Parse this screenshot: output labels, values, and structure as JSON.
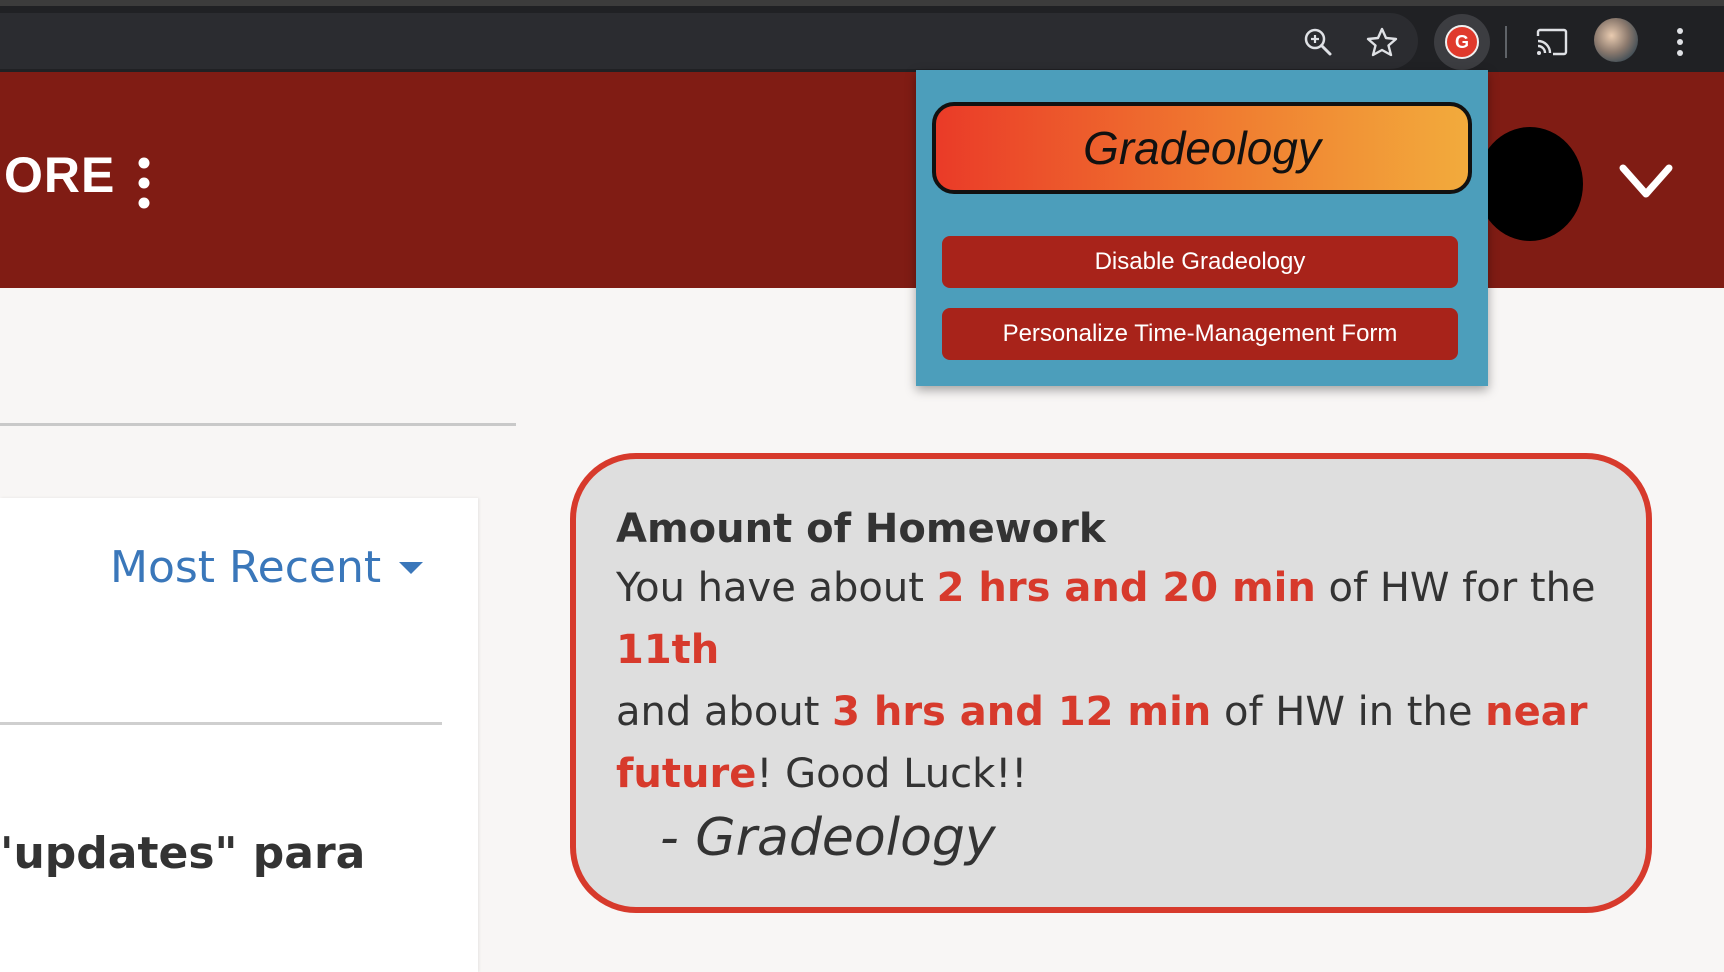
{
  "browser": {
    "icons": [
      "zoom-icon",
      "star-icon",
      "extension-icon",
      "cast-icon",
      "profile-avatar",
      "menu-icon"
    ],
    "extension_icon_letter": "G"
  },
  "header": {
    "nav_label": "ORE",
    "color": "#801c14"
  },
  "popup": {
    "title": "Gradeology",
    "buttons": {
      "disable": "Disable Gradeology",
      "personalize": "Personalize Time-Management Form"
    },
    "background": "#4c9ebb",
    "button_color": "#a8231a"
  },
  "feed": {
    "sort_label": "Most Recent",
    "post_snippet": "'updates\" para"
  },
  "homework": {
    "title": "Amount of Homework",
    "line1_prefix": "You have about ",
    "line1_amount": "2 hrs and 20 min",
    "line1_mid": " of HW for the ",
    "line1_day": "11th",
    "line2_prefix": "and about ",
    "line2_amount": "3 hrs and 12 min",
    "line2_mid": " of HW in the ",
    "line2_when": "near future",
    "line2_suffix": "! Good Luck!!",
    "signature": "- Gradeology",
    "accent_color": "#d73a2c"
  }
}
